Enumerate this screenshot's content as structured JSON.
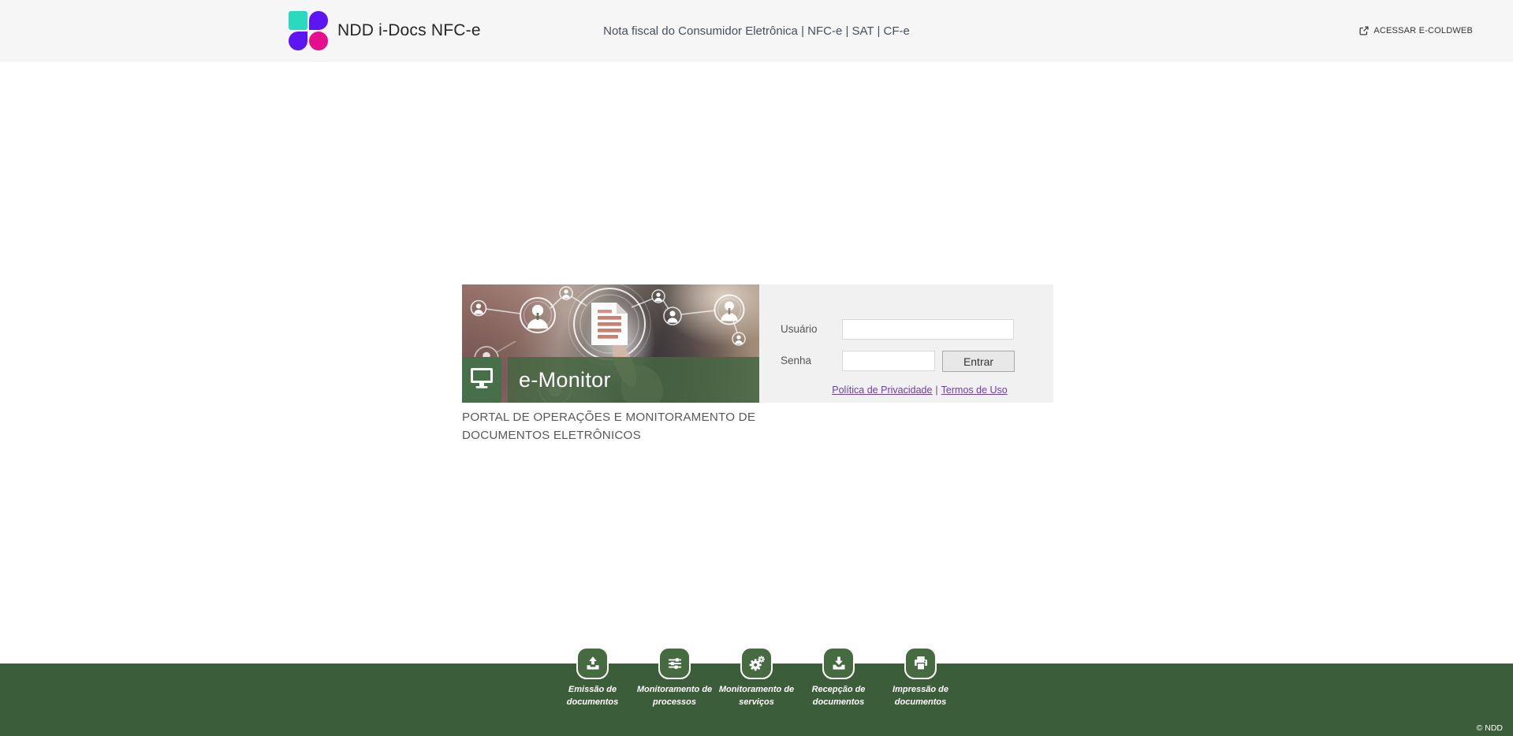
{
  "header": {
    "app_title": "NDD i-Docs NFC-e",
    "subtitle": "Nota fiscal do Consumidor Eletrônica | NFC-e | SAT | CF-e",
    "coldweb_link": "ACESSAR E-COLDWEB"
  },
  "login": {
    "banner_title": "e-Monitor",
    "caption": "PORTAL DE OPERAÇÕES E MONITORAMENTO DE DOCUMENTOS ELETRÔNICOS",
    "username_label": "Usuário",
    "username_value": "",
    "password_label": "Senha",
    "password_value": "",
    "submit_label": "Entrar",
    "privacy_link": "Política de Privacidade",
    "links_separator": "|",
    "terms_link": "Termos de Uso"
  },
  "footer": {
    "items": [
      {
        "icon": "upload-icon",
        "label": "Emissão de documentos"
      },
      {
        "icon": "sliders-icon",
        "label": "Monitoramento de processos"
      },
      {
        "icon": "gears-icon",
        "label": "Monitoramento de serviços"
      },
      {
        "icon": "download-icon",
        "label": "Recepção de documentos"
      },
      {
        "icon": "printer-icon",
        "label": "Impressão de documentos"
      }
    ],
    "copyright": "© NDD"
  },
  "colors": {
    "footer_green": "#3B5D39",
    "badge_green": "#466B41",
    "banner_green": "#47704A",
    "panel_gray": "#F1F1F1",
    "link_purple": "#6B3FA0",
    "logo_teal": "#2BD9C0",
    "logo_purple": "#5B16F2",
    "logo_pink": "#E60E8C"
  }
}
